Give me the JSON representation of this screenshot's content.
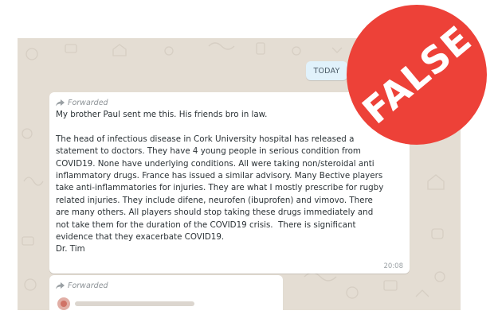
{
  "date_chip": "TODAY",
  "forwarded_label": "Forwarded",
  "message": {
    "lines": [
      "My brother Paul sent me this. His friends bro in law.",
      "",
      "The head of infectious disease in Cork University hospital has released a",
      "statement to doctors. They have 4 young people in serious condition from",
      "COVID19. None have underlying conditions. All were taking non/steroidal anti",
      "inflammatory drugs. France has issued a similar advisory. Many Bective players",
      "take anti-inflammatories for injuries. They are what I mostly prescribe for rugby",
      "related injuries. They include difene, neurofen (ibuprofen) and vimovo. There",
      "are many others. All players should stop taking these drugs immediately and",
      "not take them for the duration of the COVID19 crisis.  There is significant",
      "evidence that they exacerbate COVID19.",
      "Dr. Tim"
    ],
    "time": "20:08"
  },
  "second_message": {
    "forwarded_label": "Forwarded"
  },
  "stamp": {
    "text": "FALSE",
    "color": "#ed4138"
  },
  "colors": {
    "wallpaper": "#e4ddd3",
    "bubble": "#ffffff",
    "date_chip": "#e1f2fb"
  }
}
